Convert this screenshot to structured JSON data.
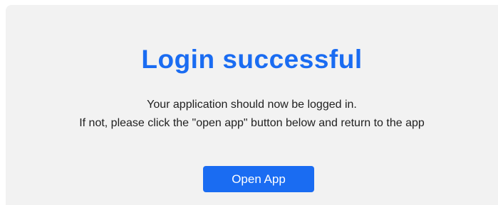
{
  "card": {
    "title": "Login successful",
    "message_line_1": "Your application should now be logged in.",
    "message_line_2": "If not, please click the \"open app\" button below and return to the app",
    "button_label": "Open App"
  },
  "colors": {
    "accent": "#1a6cf2",
    "card_background": "#f2f2f2",
    "text": "#1f1f1f"
  }
}
